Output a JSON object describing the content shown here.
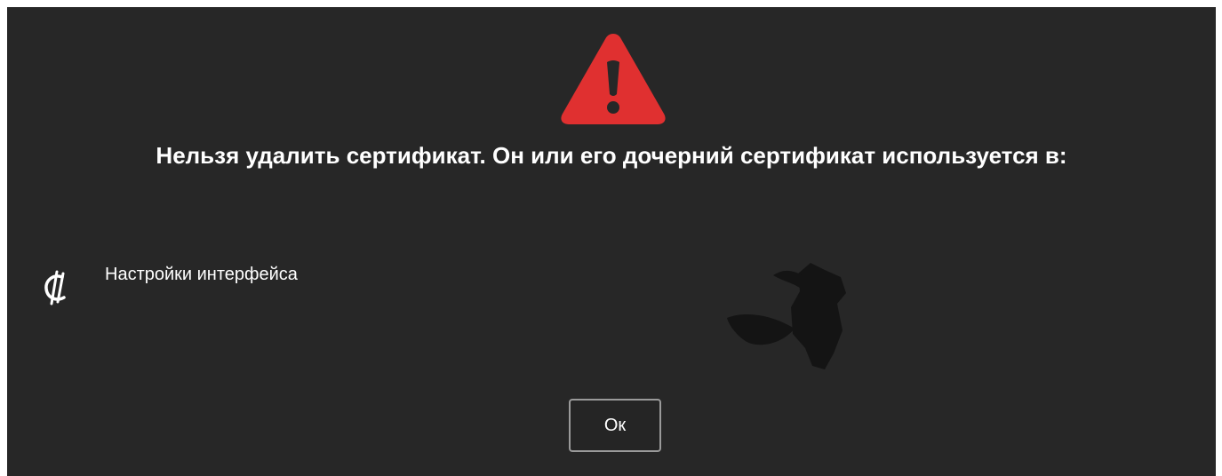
{
  "dialog": {
    "icon": "warning-triangle-icon",
    "accent_color": "#e03030",
    "title": "Нельзя удалить сертификат. Он или его дочерний сертификат используется в:",
    "usages": [
      {
        "icon": "interface-settings-icon",
        "label": "Настройки интерфейса"
      }
    ],
    "ok_label": "Ок"
  }
}
